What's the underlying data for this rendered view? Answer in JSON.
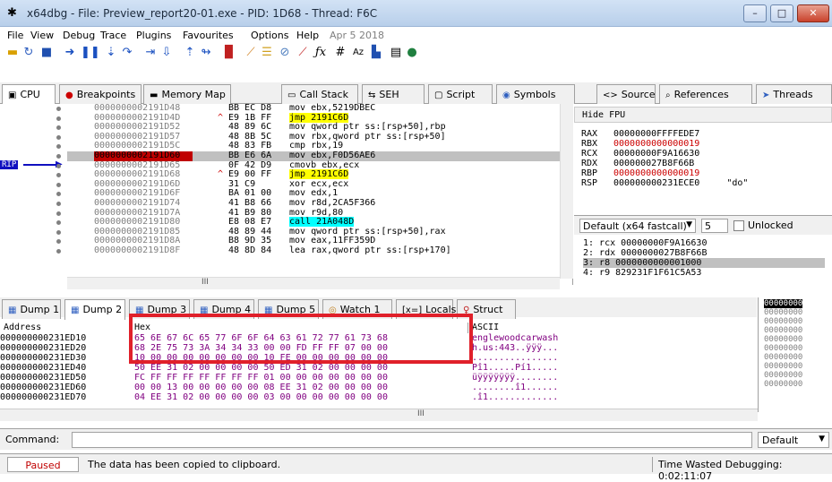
{
  "window": {
    "title": "x64dbg - File: Preview_report20-01.exe - PID: 1D68 - Thread: F6C",
    "minimize": "–",
    "maximize": "□",
    "close": "✕"
  },
  "menu": [
    "File",
    "View",
    "Debug",
    "Trace",
    "Plugins",
    "Favourites",
    "Options",
    "Help",
    "Apr 5 2018"
  ],
  "main_tabs": [
    {
      "label": "CPU",
      "icon": "cpu-icon"
    },
    {
      "label": "Breakpoints",
      "icon": "breakpoint-dot-icon"
    },
    {
      "label": "Memory Map",
      "icon": "memory-icon"
    },
    {
      "label": "Call Stack",
      "icon": "callstack-icon"
    },
    {
      "label": "SEH",
      "icon": "seh-icon"
    },
    {
      "label": "Script",
      "icon": "script-icon"
    },
    {
      "label": "Symbols",
      "icon": "symbols-icon"
    },
    {
      "label": "Source",
      "icon": "source-icon"
    },
    {
      "label": "References",
      "icon": "references-icon"
    },
    {
      "label": "Threads",
      "icon": "threads-icon"
    }
  ],
  "rip_label": "RIP",
  "disasm": [
    {
      "addr": "0000000002191D48",
      "bytes": "BB EC D8",
      "sign": "",
      "ins": "mov ebx,5219DBEC"
    },
    {
      "addr": "0000000002191D4D",
      "bytes": "E9 1B FF",
      "sign": "^",
      "ins": "jmp 2191C6D",
      "hl": "jmp"
    },
    {
      "addr": "0000000002191D52",
      "bytes": "48 89 6C",
      "sign": "",
      "ins": "mov qword ptr ss:[rsp+50],rbp"
    },
    {
      "addr": "0000000002191D57",
      "bytes": "48 8B 5C",
      "sign": "",
      "ins": "mov rbx,qword ptr ss:[rsp+50]"
    },
    {
      "addr": "0000000002191D5C",
      "bytes": "48 83 FB",
      "sign": "",
      "ins": "cmp rbx,19"
    },
    {
      "addr": "0000000002191D60",
      "bytes": "BB E6 6A",
      "sign": "",
      "ins": "mov ebx,F0D56AE6",
      "sel": true
    },
    {
      "addr": "0000000002191D65",
      "bytes": "0F 42 D9",
      "sign": "",
      "ins": "cmovb ebx,ecx"
    },
    {
      "addr": "0000000002191D68",
      "bytes": "E9 00 FF",
      "sign": "^",
      "ins": "jmp 2191C6D",
      "hl": "jmp"
    },
    {
      "addr": "0000000002191D6D",
      "bytes": "31 C9",
      "sign": "",
      "ins": "xor ecx,ecx"
    },
    {
      "addr": "0000000002191D6F",
      "bytes": "BA 01 00",
      "sign": "",
      "ins": "mov edx,1"
    },
    {
      "addr": "0000000002191D74",
      "bytes": "41 B8 66",
      "sign": "",
      "ins": "mov r8d,2CA5F366"
    },
    {
      "addr": "0000000002191D7A",
      "bytes": "41 B9 80",
      "sign": "",
      "ins": "mov r9d,80"
    },
    {
      "addr": "0000000002191D80",
      "bytes": "E8 08 E7",
      "sign": "",
      "ins": "call 21A048D",
      "hl": "call"
    },
    {
      "addr": "0000000002191D85",
      "bytes": "48 89 44",
      "sign": "",
      "ins": "mov qword ptr ss:[rsp+50],rax"
    },
    {
      "addr": "0000000002191D8A",
      "bytes": "B8 9D 35",
      "sign": "",
      "ins": "mov eax,11FF359D"
    },
    {
      "addr": "0000000002191D8F",
      "bytes": "48 8D 84",
      "sign": "",
      "ins": "lea rax,qword ptr ss:[rsp+170]"
    }
  ],
  "hscroll_mark": "III",
  "regs": {
    "hide_fpu": "Hide FPU",
    "list": [
      {
        "name": "RAX",
        "value": "00000000FFFFEDE7",
        "red": false,
        "extra": ""
      },
      {
        "name": "RBX",
        "value": "0000000000000019",
        "red": true,
        "extra": ""
      },
      {
        "name": "RCX",
        "value": "00000000F9A16630",
        "red": false,
        "extra": ""
      },
      {
        "name": "RDX",
        "value": "000000027B8F66B",
        "red": false,
        "extra": ""
      },
      {
        "name": "RBP",
        "value": "0000000000000019",
        "red": true,
        "extra": ""
      },
      {
        "name": "RSP",
        "value": "000000000231ECE0",
        "red": false,
        "extra": "\"do\""
      }
    ]
  },
  "callconv": {
    "selected": "Default (x64 fastcall)",
    "count": "5",
    "unlocked": "Unlocked"
  },
  "stack_args": [
    "1: rcx 00000000F9A16630",
    "2: rdx 0000000027B8F66B",
    "3: r8 0000000000001000",
    "4: r9 829231F1F61C5A53"
  ],
  "dump_tabs": [
    "Dump 1",
    "Dump 2",
    "Dump 3",
    "Dump 4",
    "Dump 5",
    "Watch 1",
    "Locals",
    "Struct"
  ],
  "dump_header": {
    "address": "Address",
    "hex": "Hex",
    "ascii": "ASCII"
  },
  "dump": [
    {
      "addr": "000000000231ED10",
      "hex": "65 6E 67 6C 65 77 6F 6F 64 63 61 72 77 61 73 68",
      "ascii": "englewoodcarwash"
    },
    {
      "addr": "000000000231ED20",
      "hex": "68 2E 75 73 3A 34 34 33 00 00 FD FF FF 07 00 00",
      "ascii": "h.us:443..ÿÿÿ..."
    },
    {
      "addr": "000000000231ED30",
      "hex": "10 00 00 00 00 00 00 00 10 FE 00 00 00 00 00 00",
      "ascii": "................"
    },
    {
      "addr": "000000000231ED40",
      "hex": "50 EE 31 02 00 00 00 00 50 ED 31 02 00 00 00 00",
      "ascii": "Pî1.....Pí1....."
    },
    {
      "addr": "000000000231ED50",
      "hex": "FC FF FF FF FF FF FF FF 01 00 00 00 00 00 00 00",
      "ascii": "üÿÿÿÿÿÿÿ........"
    },
    {
      "addr": "000000000231ED60",
      "hex": "00 00 13 00 00 00 00 00 08 EE 31 02 00 00 00 00",
      "ascii": "........î1......"
    },
    {
      "addr": "000000000231ED70",
      "hex": "04 EE 31 02 00 00 00 00 03 00 00 00 00 00 00 00",
      "ascii": ".î1............."
    }
  ],
  "stack_mini": [
    "00000000",
    "00000000",
    "00000000",
    "00000000",
    "00000000",
    "00000000",
    "00000000",
    "00000000",
    "00000000",
    "00000000"
  ],
  "command": {
    "label": "Command:",
    "value": "",
    "mode": "Default"
  },
  "status": {
    "state": "Paused",
    "message": "The data has been copied to clipboard.",
    "time": "Time Wasted Debugging: 0:02:11:07"
  }
}
